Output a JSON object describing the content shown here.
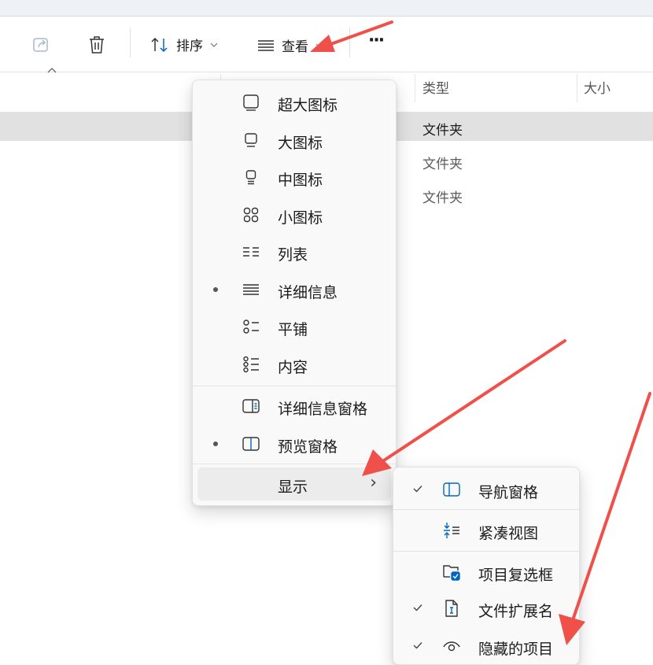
{
  "toolbar": {
    "sort_label": "排序",
    "view_label": "查看",
    "more_label": "···"
  },
  "columns": {
    "type": "类型",
    "size": "大小"
  },
  "rows": [
    "文件夹",
    "文件夹",
    "文件夹"
  ],
  "view_menu": {
    "items": [
      {
        "label": "超大图标",
        "icon": "extra-large-icon"
      },
      {
        "label": "大图标",
        "icon": "large-icon"
      },
      {
        "label": "中图标",
        "icon": "medium-icon"
      },
      {
        "label": "小图标",
        "icon": "small-icon"
      },
      {
        "label": "列表",
        "icon": "list-icon"
      },
      {
        "label": "详细信息",
        "icon": "details-icon",
        "selected": true
      },
      {
        "label": "平铺",
        "icon": "tiles-icon"
      },
      {
        "label": "内容",
        "icon": "content-icon"
      }
    ],
    "panes": [
      {
        "label": "详细信息窗格",
        "icon": "details-pane-icon"
      },
      {
        "label": "预览窗格",
        "icon": "preview-pane-icon",
        "selected": true
      }
    ],
    "show_label": "显示",
    "show_chevron": "›"
  },
  "show_submenu": {
    "items": [
      {
        "label": "导航窗格",
        "icon": "navigation-pane-icon",
        "checked": true
      },
      {
        "label": "紧凑视图",
        "icon": "compact-view-icon",
        "checked": false
      },
      {
        "label": "项目复选框",
        "icon": "item-checkbox-icon",
        "checked": false
      },
      {
        "label": "文件扩展名",
        "icon": "file-extension-icon",
        "checked": true
      },
      {
        "label": "隐藏的项目",
        "icon": "hidden-items-icon",
        "checked": true
      }
    ]
  },
  "colors": {
    "accent": "#0067c0",
    "annotation_arrow": "#f0504a",
    "selection": "#e1e1e1"
  }
}
